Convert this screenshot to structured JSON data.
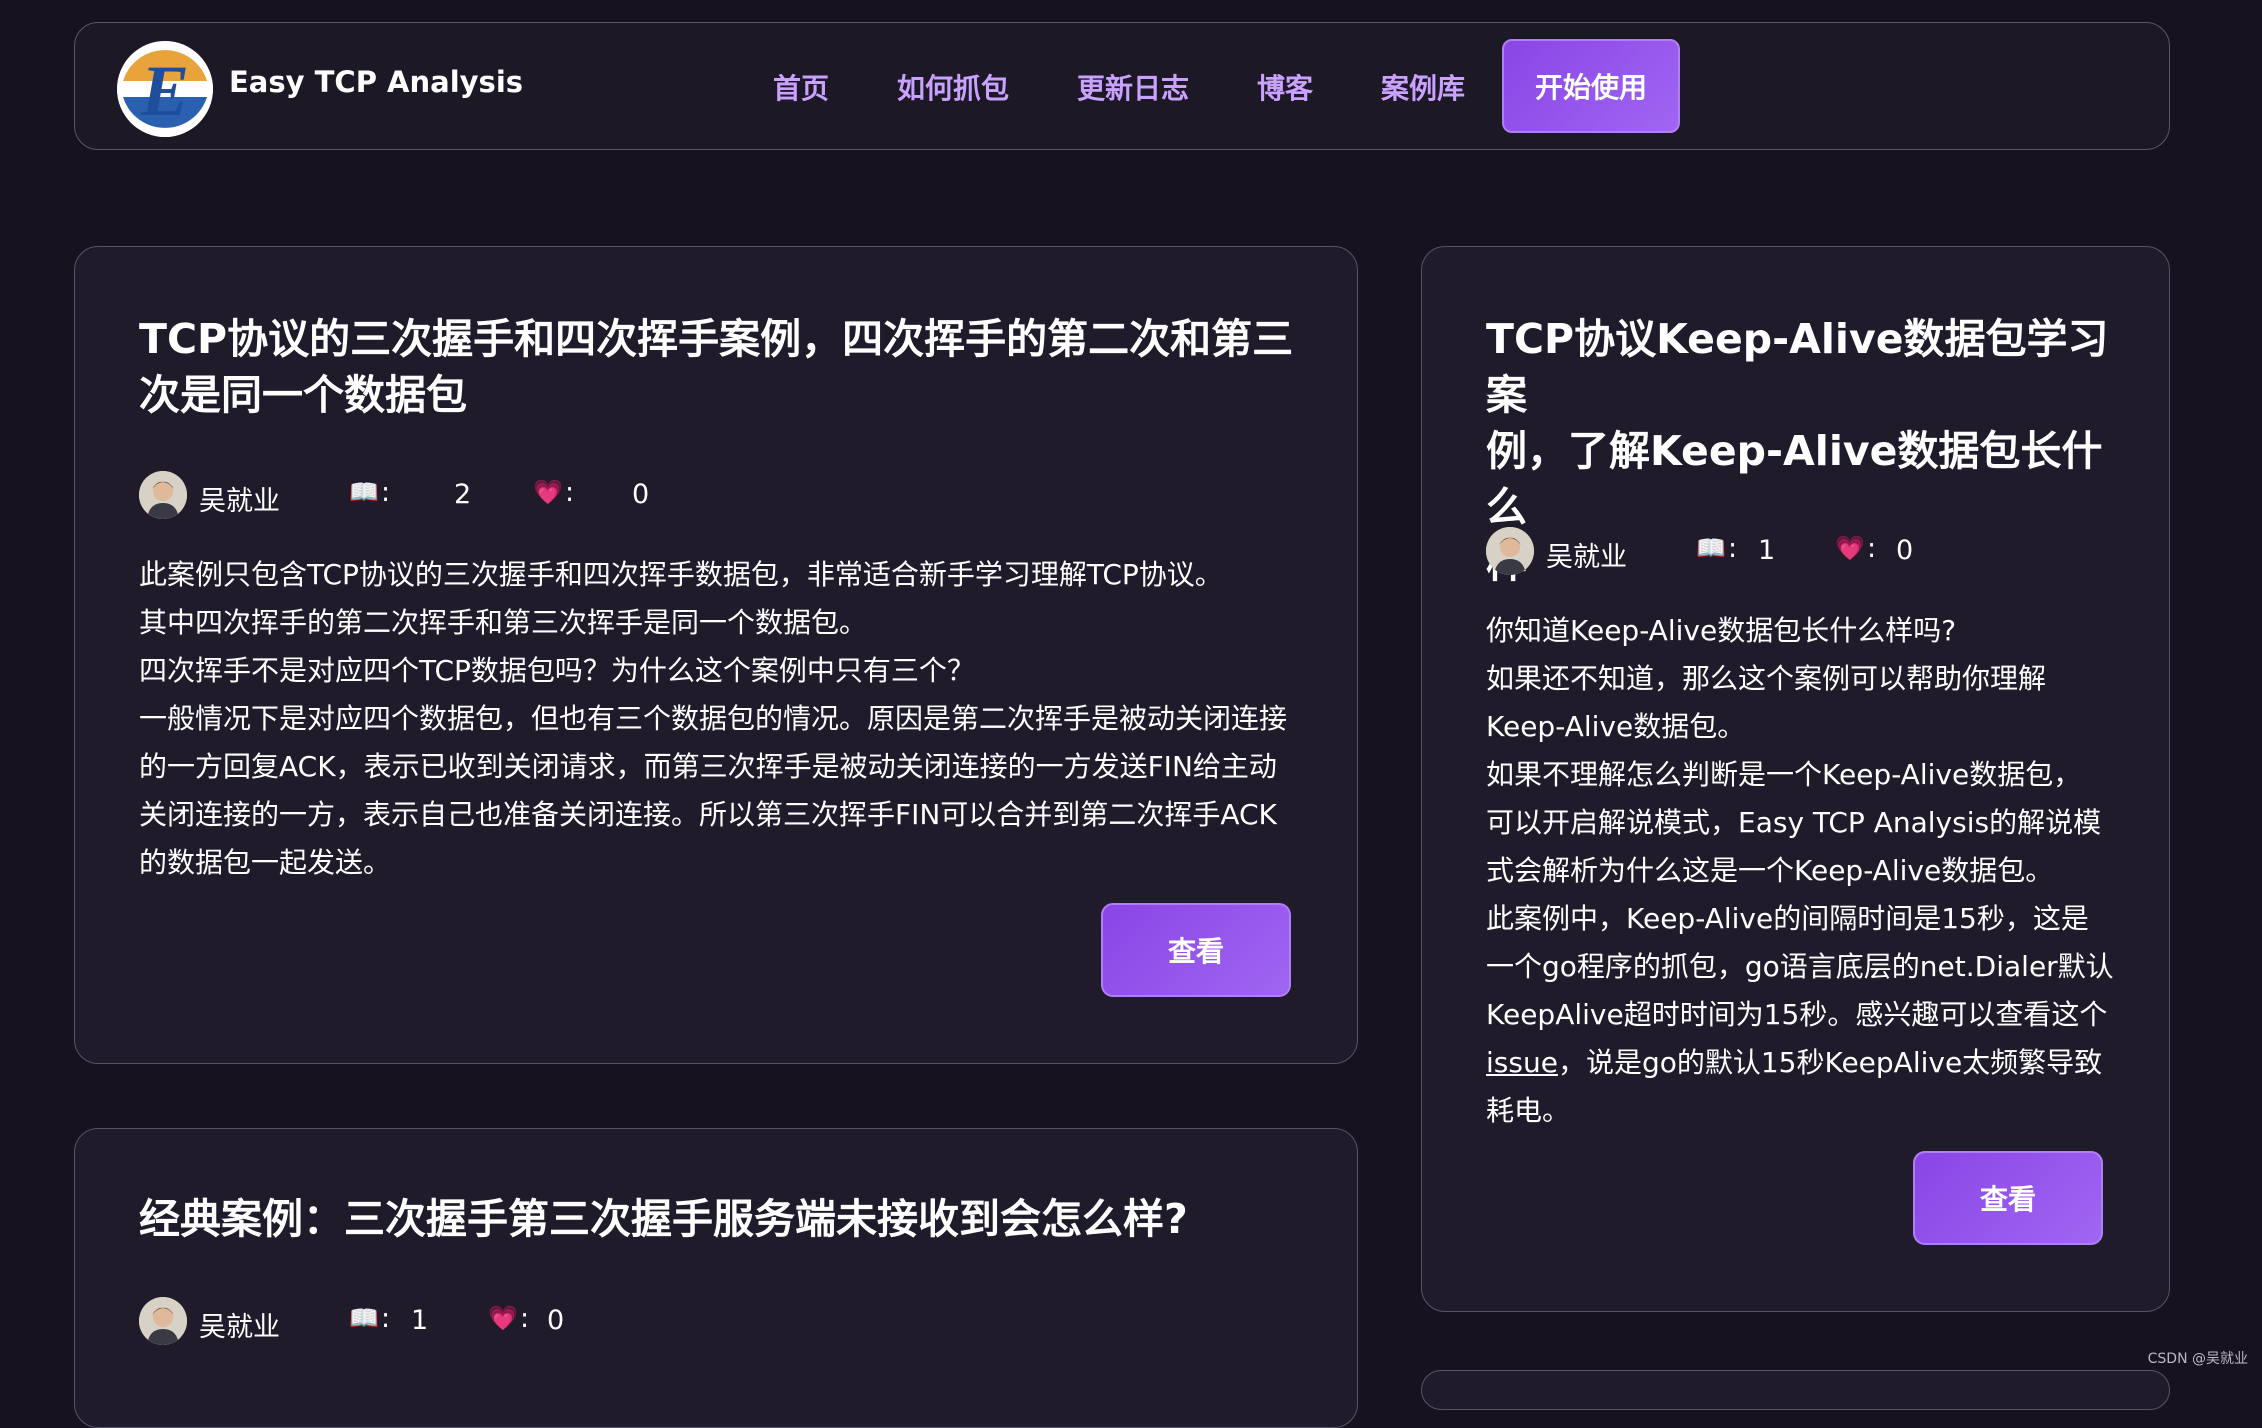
{
  "nav": {
    "brand": "Easy TCP Analysis",
    "links": [
      "首页",
      "如何抓包",
      "更新日志",
      "博客",
      "案例库"
    ],
    "cta": "开始使用"
  },
  "cards": [
    {
      "title_lines": [
        "TCP协议的三次握手和四次挥手案例，四次挥手的第二次和第三",
        "次是同一个数据包"
      ],
      "author": "吴就业",
      "read_icon": "📖",
      "like_icon": "💗",
      "colon": ":",
      "reads": "2",
      "likes": "0",
      "desc": [
        "此案例只包含TCP协议的三次握手和四次挥手数据包，非常适合新手学习理解TCP协议。",
        "其中四次挥手的第二次挥手和第三次挥手是同一个数据包。",
        "四次挥手不是对应四个TCP数据包吗？为什么这个案例中只有三个？",
        "一般情况下是对应四个数据包，但也有三个数据包的情况。原因是第二次挥手是被动关闭连接",
        "的一方回复ACK，表示已收到关闭请求，而第三次挥手是被动关闭连接的一方发送FIN给主动",
        "关闭连接的一方，表示自己也准备关闭连接。所以第三次挥手FIN可以合并到第二次挥手ACK",
        "的数据包一起发送。"
      ],
      "button": "查看"
    },
    {
      "title_lines": [
        "TCP协议Keep-Alive数据包学习案",
        "例，了解Keep-Alive数据包长什么",
        "样"
      ],
      "author": "吴就业",
      "read_icon": "📖",
      "like_icon": "💗",
      "colon": ":",
      "reads": "1",
      "likes": "0",
      "desc": [
        "你知道Keep-Alive数据包长什么样吗?",
        "如果还不知道，那么这个案例可以帮助你理解",
        "Keep-Alive数据包。",
        "如果不理解怎么判断是一个Keep-Alive数据包，",
        "可以开启解说模式，Easy TCP Analysis的解说模",
        "式会解析为什么这是一个Keep-Alive数据包。",
        "此案例中，Keep-Alive的间隔时间是15秒，这是",
        "一个go程序的抓包，go语言底层的net.Dialer默认",
        "KeepAlive超时时间为15秒。感兴趣可以查看这个"
      ],
      "desc_link": "issue",
      "desc_tail": "，说是go的默认15秒KeepAlive太频繁导致",
      "desc_last": "耗电。",
      "button": "查看"
    },
    {
      "title_lines": [
        "经典案例：三次握手第三次握手服务端未接收到会怎么样?"
      ],
      "author": "吴就业",
      "read_icon": "📖",
      "like_icon": "💗",
      "colon": ":",
      "reads": "1",
      "likes": "0"
    }
  ],
  "watermark": "CSDN @吴就业"
}
